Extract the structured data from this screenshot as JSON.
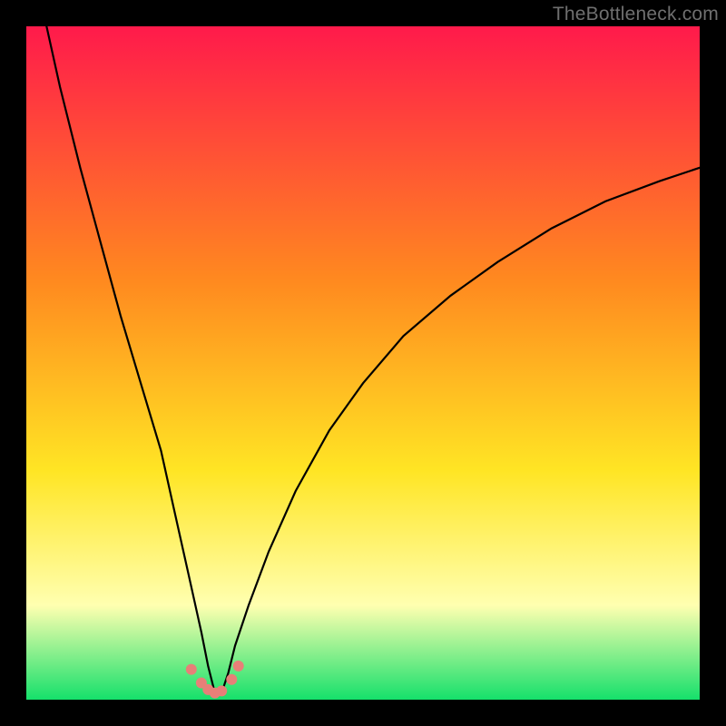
{
  "watermark": "TheBottleneck.com",
  "colors": {
    "gradient_top": "#ff1a4b",
    "gradient_mid1": "#ff8a1f",
    "gradient_mid2": "#ffe524",
    "gradient_pale": "#ffffb0",
    "gradient_bottom": "#15e06b",
    "curve": "#000000",
    "markers": "#e77f78",
    "frame": "#000000"
  },
  "chart_data": {
    "type": "line",
    "title": "",
    "xlabel": "",
    "ylabel": "",
    "xlim": [
      0,
      100
    ],
    "ylim": [
      0,
      100
    ],
    "minimum_x": 28,
    "series": [
      {
        "name": "bottleneck-curve",
        "x": [
          3,
          5,
          8,
          11,
          14,
          17,
          20,
          22,
          24,
          26,
          27,
          28,
          29,
          30,
          31,
          33,
          36,
          40,
          45,
          50,
          56,
          63,
          70,
          78,
          86,
          94,
          100
        ],
        "values": [
          100,
          91,
          79,
          68,
          57,
          47,
          37,
          28,
          19,
          10,
          5,
          1,
          1,
          4,
          8,
          14,
          22,
          31,
          40,
          47,
          54,
          60,
          65,
          70,
          74,
          77,
          79
        ]
      }
    ],
    "markers": {
      "name": "near-minimum-samples",
      "x": [
        24.5,
        26.0,
        27.0,
        28.0,
        29.0,
        30.5,
        31.5
      ],
      "values": [
        4.5,
        2.5,
        1.5,
        1.0,
        1.3,
        3.0,
        5.0
      ]
    }
  }
}
